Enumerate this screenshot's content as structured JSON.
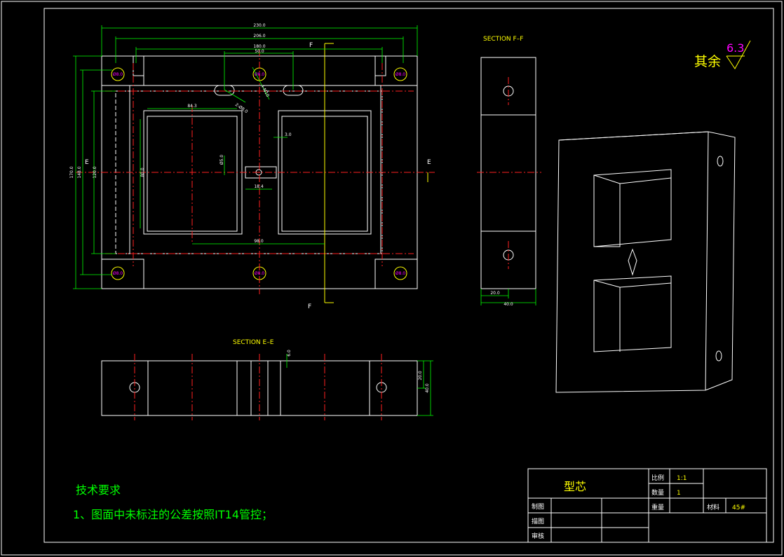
{
  "colors": {
    "background": "#000000",
    "outline": "#ffffff",
    "dimension": "#00ff00",
    "centerline": "#ff2020",
    "label": "#ffff00",
    "roughness_value": "#ff00ff"
  },
  "main_view": {
    "dims": {
      "d230": "230.0",
      "d206": "206.0",
      "d180": "180.0",
      "d50": "50.0",
      "d170": "170.0",
      "d148": "148.0",
      "d120": "120.0",
      "d80": "80.0",
      "d84_3": "84.3",
      "d98": "98.0",
      "d3": "3.0",
      "d5": "Ø5.0",
      "d18_4": "18.4",
      "hole_a": "2-Ø8.0",
      "hole_b": "4-M10",
      "hole_tag": "Ø8.0"
    },
    "section_marks": {
      "e": "E",
      "f": "F"
    }
  },
  "section_ff": {
    "title": "SECTION F–F",
    "dim_20": "20.0",
    "dim_40": "40.0"
  },
  "section_ee": {
    "title": "SECTION E–E",
    "dim_6": "6.0",
    "dim_20": "20.0",
    "dim_40": "40.0"
  },
  "roughness": {
    "prefix": "其余",
    "value": "6.3"
  },
  "technical_notes": {
    "heading": "技术要求",
    "items": [
      "1、图面中未标注的公差按照IT14管控；"
    ]
  },
  "title_block": {
    "part_name": "型芯",
    "scale_label": "比例",
    "scale_value": "1:1",
    "qty_label": "数量",
    "qty_value": "1",
    "weight_label": "重量",
    "material_label": "材料",
    "material_value": "45#",
    "drawn_label": "制图",
    "traced_label": "描图",
    "checked_label": "审核"
  }
}
